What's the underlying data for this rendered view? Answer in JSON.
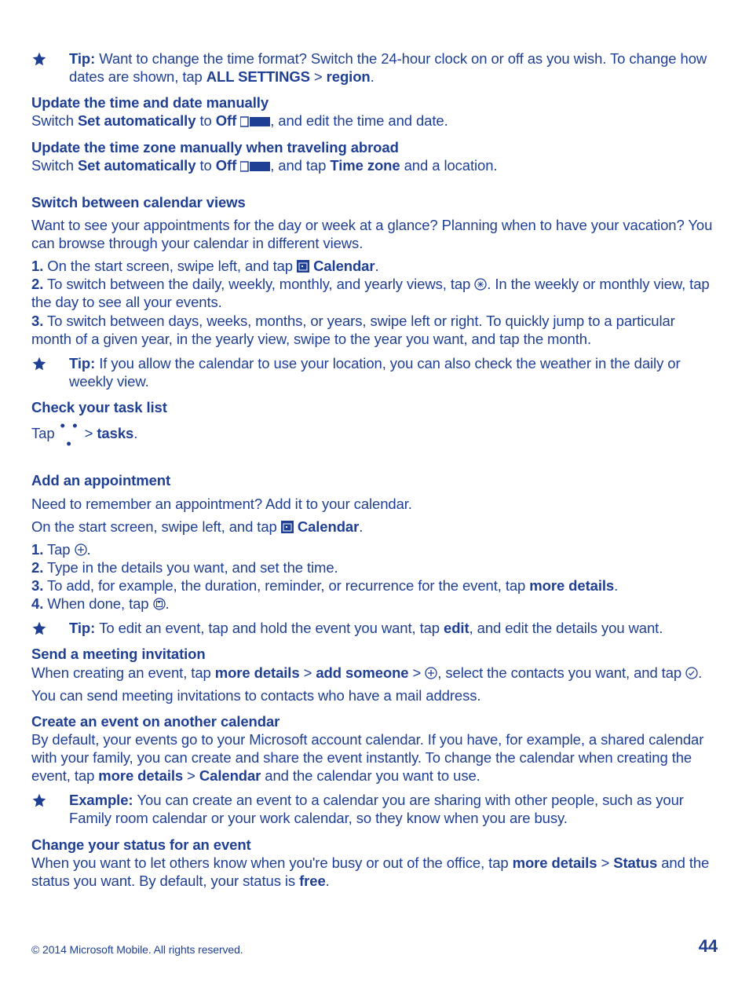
{
  "tip1": {
    "label": "Tip: ",
    "text_a": "Want to change the time format? Switch the 24-hour clock on or off as you wish. To change how dates are shown, tap ",
    "bold1": "ALL SETTINGS",
    "sep": " > ",
    "bold2": "region",
    "end": "."
  },
  "update_time": {
    "heading": "Update the time and date manually",
    "pre": "Switch ",
    "b1": "Set automatically",
    "mid": " to ",
    "b2": "Off",
    "sp": " ",
    "post": ", and edit the time and date."
  },
  "update_tz": {
    "heading": "Update the time zone manually when traveling abroad",
    "pre": "Switch ",
    "b1": "Set automatically",
    "mid": " to ",
    "b2": "Off",
    "sp": " ",
    "post_a": ", and tap ",
    "b3": "Time zone",
    "post_b": " and a location."
  },
  "switch_views": {
    "heading": "Switch between calendar views",
    "intro": "Want to see your appointments for the day or week at a glance? Planning when to have your vacation? You can browse through your calendar in different views.",
    "s1_n": "1.",
    "s1_a": " On the start screen, swipe left, and tap ",
    "s1_b": "Calendar",
    "s1_c": ".",
    "s2_n": "2.",
    "s2_a": " To switch between the daily, weekly, monthly, and yearly views, tap ",
    "s2_b": ". In the weekly or monthly view, tap the day to see all your events.",
    "s3_n": "3.",
    "s3_a": " To switch between days, weeks, months, or years, swipe left or right. To quickly jump to a particular month of a given year, in the yearly view, swipe to the year you want, and tap the month."
  },
  "tip2": {
    "label": "Tip: ",
    "text": "If you allow the calendar to use your location, you can also check the weather in the daily or weekly view."
  },
  "task_list": {
    "heading": "Check your task list",
    "pre": "Tap ",
    "mid": " > ",
    "b": "tasks",
    "end": "."
  },
  "add_appt": {
    "heading": "Add an appointment",
    "intro": "Need to remember an appointment? Add it to your calendar.",
    "start_a": "On the start screen, swipe left, and tap ",
    "start_b": "Calendar",
    "start_c": ".",
    "s1_n": "1.",
    "s1_a": " Tap ",
    "s1_b": ".",
    "s2_n": "2.",
    "s2_a": " Type in the details you want, and set the time.",
    "s3_n": "3.",
    "s3_a": " To add, for example, the duration, reminder, or recurrence for the event, tap ",
    "s3_b": "more details",
    "s3_c": ".",
    "s4_n": "4.",
    "s4_a": " When done, tap ",
    "s4_b": "."
  },
  "tip3": {
    "label": "Tip: ",
    "text_a": "To edit an event, tap and hold the event you want, tap ",
    "b": "edit",
    "text_b": ", and edit the details you want."
  },
  "send_meeting": {
    "heading": "Send a meeting invitation",
    "a": "When creating an event, tap ",
    "b1": "more details",
    "sep": " > ",
    "b2": "add someone",
    "mid": " > ",
    "post_a": ", select the contacts you want, and tap ",
    "post_b": ".",
    "note": "You can send meeting invitations to contacts who have a mail address."
  },
  "create_other": {
    "heading": "Create an event on another calendar",
    "a": "By default, your events go to your Microsoft account calendar. If you have, for example, a shared calendar with your family, you can create and share the event instantly. To change the calendar when creating the event, tap ",
    "b1": "more details",
    "sep": " > ",
    "b2": "Calendar",
    "c": " and the calendar you want to use."
  },
  "example1": {
    "label": "Example: ",
    "text": "You can create an event to a calendar you are sharing with other people, such as your Family room calendar or your work calendar, so they know when you are busy."
  },
  "change_status": {
    "heading": "Change your status for an event",
    "a": "When you want to let others know when you're busy or out of the office, tap ",
    "b1": "more details",
    "sep": " > ",
    "b2": "Status",
    "c": " and the status you want. By default, your status is ",
    "b3": "free",
    "d": "."
  },
  "footer": {
    "copyright": "© 2014 Microsoft Mobile. All rights reserved.",
    "page": "44"
  },
  "dots": "• • •"
}
